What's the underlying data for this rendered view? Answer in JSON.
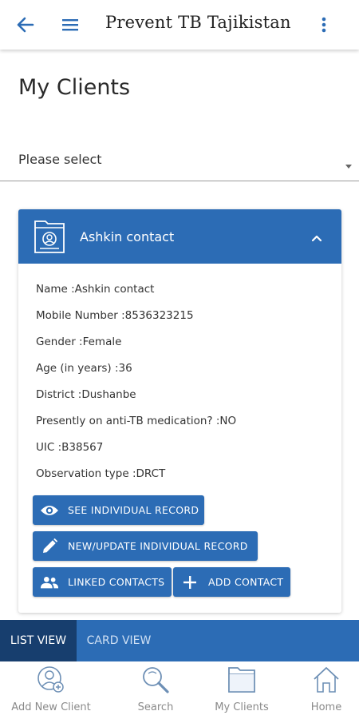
{
  "app": {
    "title": "Prevent TB Tajikistan"
  },
  "page": {
    "title": "My Clients"
  },
  "select": {
    "value": "Please select"
  },
  "card": {
    "header": "Ashkin contact",
    "fields": [
      "Name :Ashkin contact",
      "Mobile Number :8536323215",
      "Gender :Female",
      "Age (in years) :36",
      "District :Dushanbe",
      "Presently on anti-TB medication? :NO",
      "UIC :B38567",
      "Observation type :DRCT"
    ],
    "buttons": {
      "see": "SEE INDIVIDUAL RECORD",
      "update": "NEW/UPDATE INDIVIDUAL RECORD",
      "linked": "LINKED CONTACTS",
      "add": "ADD CONTACT"
    }
  },
  "view_toggle": {
    "list": "LIST VIEW",
    "card": "CARD VIEW",
    "active": "list"
  },
  "bottom_nav": [
    {
      "label": "Add New Client",
      "icon": "add-client-icon"
    },
    {
      "label": "Search",
      "icon": "search-icon"
    },
    {
      "label": "My Clients",
      "icon": "folder-icon"
    },
    {
      "label": "Home",
      "icon": "home-icon"
    }
  ],
  "colors": {
    "primary": "#2c6cb5",
    "primary_dark": "#173e6e",
    "nav_icon": "#6d8fb5"
  }
}
